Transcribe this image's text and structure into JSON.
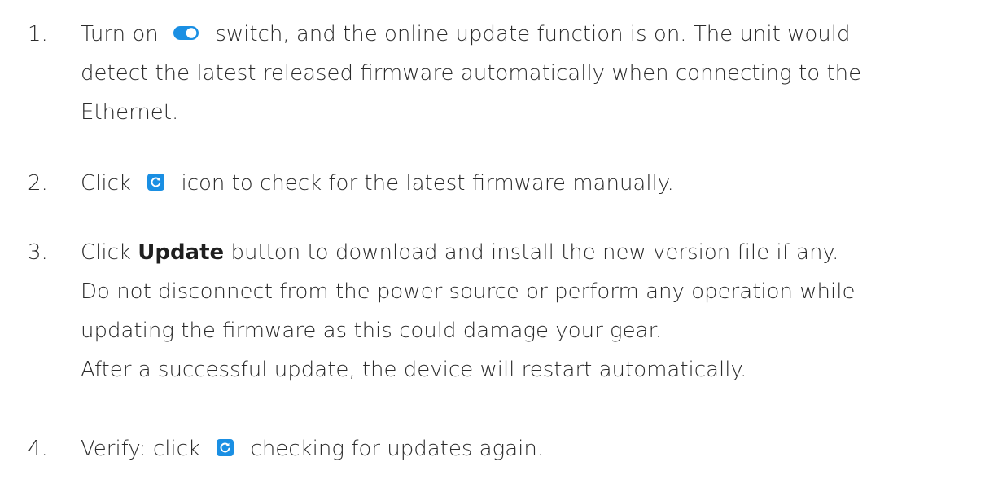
{
  "steps": [
    {
      "number": "1.",
      "lines": {
        "l1_before": "Turn on",
        "l1_after": "switch, and the online update function is on. The unit would",
        "l2": "detect the latest released firmware automatically when connecting to the",
        "l3": "Ethernet."
      },
      "icon": "toggle-switch-icon"
    },
    {
      "number": "2.",
      "lines": {
        "l1_before": "Click",
        "l1_after": "icon to check for the latest firmware manually."
      },
      "icon": "refresh-icon"
    },
    {
      "number": "3.",
      "lines": {
        "l1_before": "Click",
        "l1_bold": "Update",
        "l1_after": "button to download and install the new version file if any.",
        "l2": "Do not disconnect from the power source or perform any operation while",
        "l3": "updating the firmware as this could damage your gear.",
        "l4": "After a successful update, the device will restart automatically."
      }
    },
    {
      "number": "4.",
      "lines": {
        "l1_before": "Verify: click",
        "l1_after": "checking for updates again."
      },
      "icon": "refresh-icon"
    }
  ],
  "colors": {
    "text": "#2b2b2b",
    "icon_blue": "#1a8fe3"
  }
}
